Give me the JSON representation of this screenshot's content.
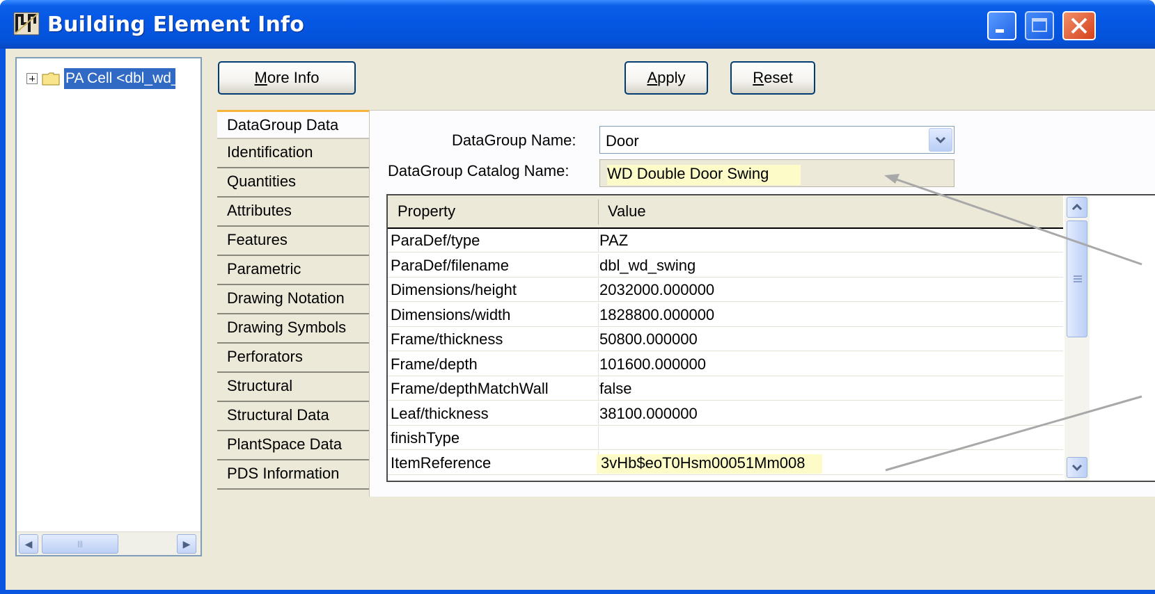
{
  "window": {
    "title": "Building Element Info"
  },
  "tree": {
    "node_label": "PA Cell <dbl_wd_swing>"
  },
  "toolbar": {
    "more_info": "More Info",
    "more_info_mnemonic": "M",
    "more_info_rest": "ore Info",
    "apply_mnemonic": "A",
    "apply_rest": "pply",
    "reset_mnemonic": "R",
    "reset_rest": "eset"
  },
  "tabs": [
    "DataGroup Data",
    "Identification",
    "Quantities",
    "Attributes",
    "Features",
    "Parametric",
    "Drawing Notation",
    "Drawing Symbols",
    "Perforators",
    "Structural",
    "Structural Data",
    "PlantSpace Data",
    "PDS Information"
  ],
  "form": {
    "datagroup_name_label": "DataGroup Name:",
    "datagroup_name_value": "Door",
    "catalog_name_label": "DataGroup Catalog Name:",
    "catalog_name_value": "WD Double Door Swing"
  },
  "grid": {
    "headers": {
      "property": "Property",
      "value": "Value"
    },
    "rows": [
      {
        "property": "ParaDef/type",
        "value": "PAZ"
      },
      {
        "property": "ParaDef/filename",
        "value": "dbl_wd_swing"
      },
      {
        "property": "Dimensions/height",
        "value": "2032000.000000"
      },
      {
        "property": "Dimensions/width",
        "value": "1828800.000000"
      },
      {
        "property": "Frame/thickness",
        "value": "50800.000000"
      },
      {
        "property": "Frame/depth",
        "value": "101600.000000"
      },
      {
        "property": "Frame/depthMatchWall",
        "value": "false"
      },
      {
        "property": "Leaf/thickness",
        "value": "38100.000000"
      },
      {
        "property": "finishType",
        "value": ""
      },
      {
        "property": "ItemReference",
        "value": "3vHb$eoT0Hsm00051Mm008"
      }
    ]
  },
  "colors": {
    "titlebar": "#0556e3",
    "selection": "#316ac5",
    "highlight": "#fdfcc8",
    "tab_accent": "#f5b33a",
    "panel": "#ece9d8"
  }
}
